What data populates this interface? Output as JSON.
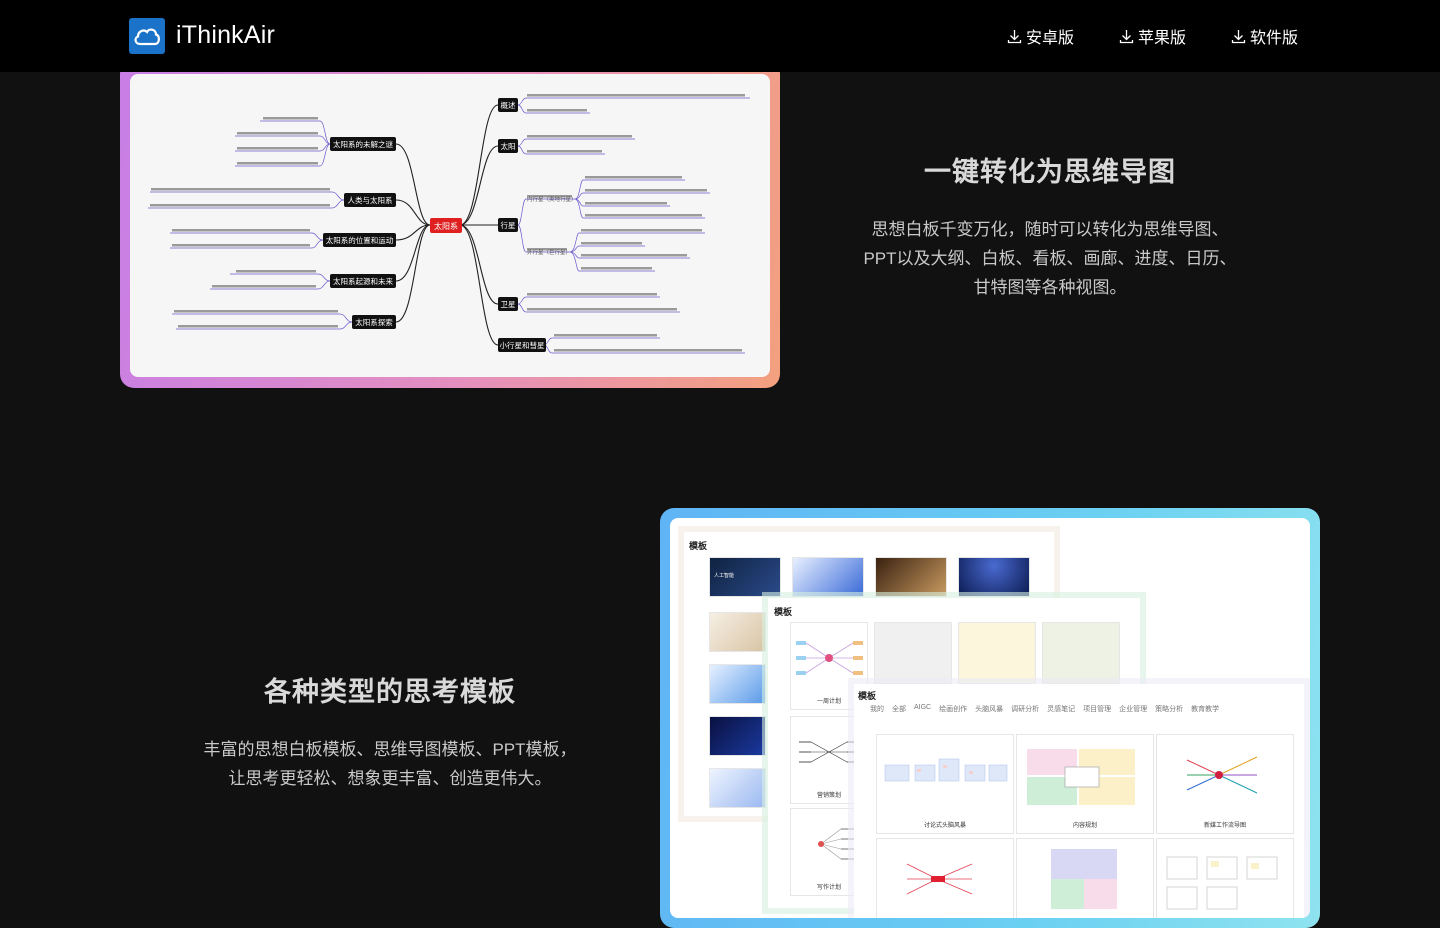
{
  "header": {
    "brand": "iThinkAir",
    "nav": [
      {
        "label": "安卓版",
        "icon": "download-icon"
      },
      {
        "label": "苹果版",
        "icon": "download-icon"
      },
      {
        "label": "软件版",
        "icon": "download-icon"
      }
    ]
  },
  "section1": {
    "title": "一键转化为思维导图",
    "desc_lines": [
      "思想白板千变万化，随时可以转化为思维导图、",
      "PPT以及大纲、白板、看板、画廊、进度、日历、",
      "甘特图等各种视图。"
    ],
    "mindmap": {
      "center": "太阳系",
      "left_branches": [
        "太阳系的未解之谜",
        "人类与太阳系",
        "太阳系的位置和运动",
        "太阳系起源和未来",
        "太阳系探索"
      ],
      "right_branches": [
        "概述",
        "太阳",
        "行星",
        "卫星",
        "小行星和彗星"
      ],
      "sub_groups": [
        "内行星（类地行星）",
        "外行星（巨行星）"
      ]
    }
  },
  "section2": {
    "title": "各种类型的思考模板",
    "desc_lines": [
      "丰富的思想白板模板、思维导图模板、PPT模板，",
      "让思考更轻松、想象更丰富、创造更伟大。"
    ],
    "panel_title": "模板",
    "tabs": [
      "我的",
      "全部",
      "AIGC",
      "绘画创作",
      "头脑风暴",
      "调研分析",
      "灵感笔记",
      "项目管理",
      "企业管理",
      "策略分析",
      "教育教学"
    ],
    "ppt_thumb_label": "人工智能",
    "mindmap_labels": [
      "一周计划",
      "营销策划",
      "写作计划"
    ],
    "board_labels": [
      "讨论式头脑风暴",
      "内容规划",
      "新媒工作流导图"
    ]
  }
}
